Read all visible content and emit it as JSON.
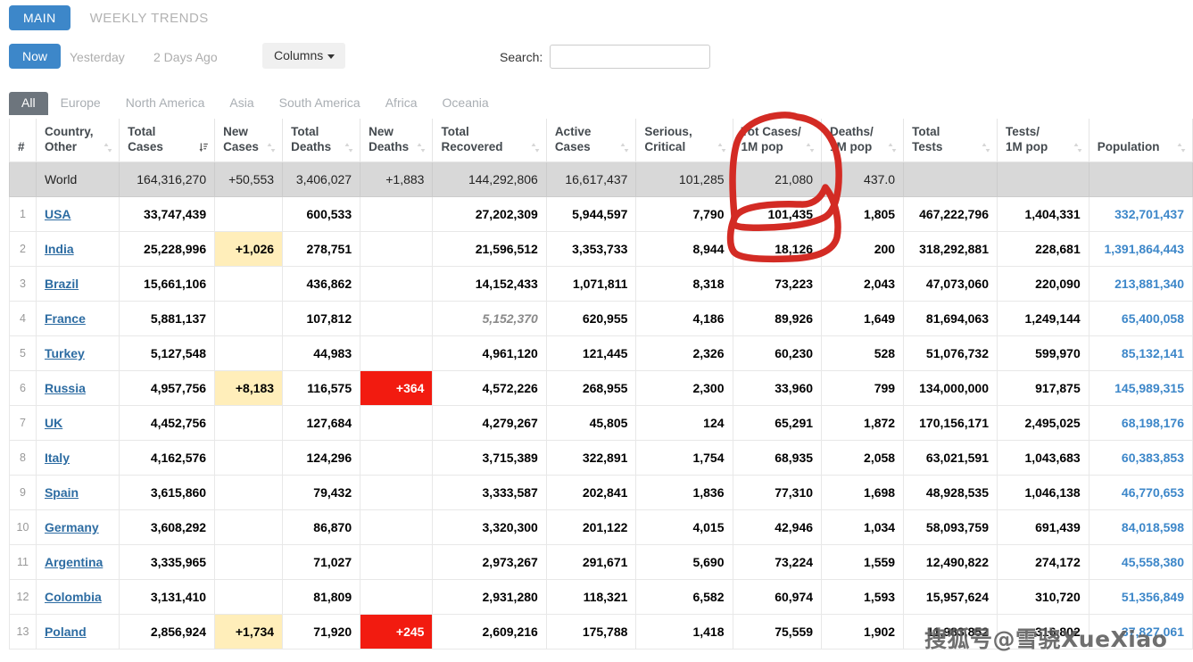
{
  "topnav": {
    "main_tab": "MAIN",
    "weekly_tab": "WEEKLY TRENDS"
  },
  "controls": {
    "now": "Now",
    "yesterday": "Yesterday",
    "two_days_ago": "2 Days Ago",
    "columns_button": "Columns",
    "search_label": "Search:",
    "search_value": "",
    "search_placeholder": ""
  },
  "continent_tabs": [
    {
      "label": "All",
      "active": true
    },
    {
      "label": "Europe",
      "active": false
    },
    {
      "label": "North America",
      "active": false
    },
    {
      "label": "Asia",
      "active": false
    },
    {
      "label": "South America",
      "active": false
    },
    {
      "label": "Africa",
      "active": false
    },
    {
      "label": "Oceania",
      "active": false
    }
  ],
  "columns": [
    {
      "key": "idx",
      "line1": "",
      "line2": "#",
      "sort": "none"
    },
    {
      "key": "country",
      "line1": "Country,",
      "line2": "Other",
      "sort": "both"
    },
    {
      "key": "total_cases",
      "line1": "Total",
      "line2": "Cases",
      "sort": "desc"
    },
    {
      "key": "new_cases",
      "line1": "New",
      "line2": "Cases",
      "sort": "both"
    },
    {
      "key": "total_deaths",
      "line1": "Total",
      "line2": "Deaths",
      "sort": "both"
    },
    {
      "key": "new_deaths",
      "line1": "New",
      "line2": "Deaths",
      "sort": "both"
    },
    {
      "key": "total_recovered",
      "line1": "Total",
      "line2": "Recovered",
      "sort": "both"
    },
    {
      "key": "active_cases",
      "line1": "Active",
      "line2": "Cases",
      "sort": "both"
    },
    {
      "key": "serious_critical",
      "line1": "Serious,",
      "line2": "Critical",
      "sort": "both"
    },
    {
      "key": "tot_cases_1m",
      "line1": "Tot Cases/",
      "line2": "1M pop",
      "sort": "both"
    },
    {
      "key": "deaths_1m",
      "line1": "Deaths/",
      "line2": "1M pop",
      "sort": "both"
    },
    {
      "key": "total_tests",
      "line1": "Total",
      "line2": "Tests",
      "sort": "both"
    },
    {
      "key": "tests_1m",
      "line1": "Tests/",
      "line2": "1M pop",
      "sort": "both"
    },
    {
      "key": "population",
      "line1": "",
      "line2": "Population",
      "sort": "both"
    }
  ],
  "world_row": {
    "idx": "",
    "country": "World",
    "total_cases": "164,316,270",
    "new_cases": "+50,553",
    "total_deaths": "3,406,027",
    "new_deaths": "+1,883",
    "total_recovered": "144,292,806",
    "active_cases": "16,617,437",
    "serious_critical": "101,285",
    "tot_cases_1m": "21,080",
    "deaths_1m": "437.0",
    "total_tests": "",
    "tests_1m": "",
    "population": ""
  },
  "rows": [
    {
      "idx": "1",
      "country": "USA",
      "total_cases": "33,747,439",
      "new_cases": "",
      "new_cases_style": "none",
      "total_deaths": "600,533",
      "new_deaths": "",
      "new_deaths_style": "none",
      "total_recovered": "27,202,309",
      "recovered_style": "normal",
      "active_cases": "5,944,597",
      "serious_critical": "7,790",
      "tot_cases_1m": "101,435",
      "deaths_1m": "1,805",
      "total_tests": "467,222,796",
      "tests_1m": "1,404,331",
      "population": "332,701,437"
    },
    {
      "idx": "2",
      "country": "India",
      "total_cases": "25,228,996",
      "new_cases": "+1,026",
      "new_cases_style": "yellow",
      "total_deaths": "278,751",
      "new_deaths": "",
      "new_deaths_style": "none",
      "total_recovered": "21,596,512",
      "recovered_style": "normal",
      "active_cases": "3,353,733",
      "serious_critical": "8,944",
      "tot_cases_1m": "18,126",
      "deaths_1m": "200",
      "total_tests": "318,292,881",
      "tests_1m": "228,681",
      "population": "1,391,864,443"
    },
    {
      "idx": "3",
      "country": "Brazil",
      "total_cases": "15,661,106",
      "new_cases": "",
      "new_cases_style": "none",
      "total_deaths": "436,862",
      "new_deaths": "",
      "new_deaths_style": "none",
      "total_recovered": "14,152,433",
      "recovered_style": "normal",
      "active_cases": "1,071,811",
      "serious_critical": "8,318",
      "tot_cases_1m": "73,223",
      "deaths_1m": "2,043",
      "total_tests": "47,073,060",
      "tests_1m": "220,090",
      "population": "213,881,340"
    },
    {
      "idx": "4",
      "country": "France",
      "total_cases": "5,881,137",
      "new_cases": "",
      "new_cases_style": "none",
      "total_deaths": "107,812",
      "new_deaths": "",
      "new_deaths_style": "none",
      "total_recovered": "5,152,370",
      "recovered_style": "dim-italic",
      "active_cases": "620,955",
      "serious_critical": "4,186",
      "tot_cases_1m": "89,926",
      "deaths_1m": "1,649",
      "total_tests": "81,694,063",
      "tests_1m": "1,249,144",
      "population": "65,400,058"
    },
    {
      "idx": "5",
      "country": "Turkey",
      "total_cases": "5,127,548",
      "new_cases": "",
      "new_cases_style": "none",
      "total_deaths": "44,983",
      "new_deaths": "",
      "new_deaths_style": "none",
      "total_recovered": "4,961,120",
      "recovered_style": "normal",
      "active_cases": "121,445",
      "serious_critical": "2,326",
      "tot_cases_1m": "60,230",
      "deaths_1m": "528",
      "total_tests": "51,076,732",
      "tests_1m": "599,970",
      "population": "85,132,141"
    },
    {
      "idx": "6",
      "country": "Russia",
      "total_cases": "4,957,756",
      "new_cases": "+8,183",
      "new_cases_style": "yellow",
      "total_deaths": "116,575",
      "new_deaths": "+364",
      "new_deaths_style": "red",
      "total_recovered": "4,572,226",
      "recovered_style": "normal",
      "active_cases": "268,955",
      "serious_critical": "2,300",
      "tot_cases_1m": "33,960",
      "deaths_1m": "799",
      "total_tests": "134,000,000",
      "tests_1m": "917,875",
      "population": "145,989,315"
    },
    {
      "idx": "7",
      "country": "UK",
      "total_cases": "4,452,756",
      "new_cases": "",
      "new_cases_style": "none",
      "total_deaths": "127,684",
      "new_deaths": "",
      "new_deaths_style": "none",
      "total_recovered": "4,279,267",
      "recovered_style": "normal",
      "active_cases": "45,805",
      "serious_critical": "124",
      "tot_cases_1m": "65,291",
      "deaths_1m": "1,872",
      "total_tests": "170,156,171",
      "tests_1m": "2,495,025",
      "population": "68,198,176"
    },
    {
      "idx": "8",
      "country": "Italy",
      "total_cases": "4,162,576",
      "new_cases": "",
      "new_cases_style": "none",
      "total_deaths": "124,296",
      "new_deaths": "",
      "new_deaths_style": "none",
      "total_recovered": "3,715,389",
      "recovered_style": "normal",
      "active_cases": "322,891",
      "serious_critical": "1,754",
      "tot_cases_1m": "68,935",
      "deaths_1m": "2,058",
      "total_tests": "63,021,591",
      "tests_1m": "1,043,683",
      "population": "60,383,853"
    },
    {
      "idx": "9",
      "country": "Spain",
      "total_cases": "3,615,860",
      "new_cases": "",
      "new_cases_style": "none",
      "total_deaths": "79,432",
      "new_deaths": "",
      "new_deaths_style": "none",
      "total_recovered": "3,333,587",
      "recovered_style": "normal",
      "active_cases": "202,841",
      "serious_critical": "1,836",
      "tot_cases_1m": "77,310",
      "deaths_1m": "1,698",
      "total_tests": "48,928,535",
      "tests_1m": "1,046,138",
      "population": "46,770,653"
    },
    {
      "idx": "10",
      "country": "Germany",
      "total_cases": "3,608,292",
      "new_cases": "",
      "new_cases_style": "none",
      "total_deaths": "86,870",
      "new_deaths": "",
      "new_deaths_style": "none",
      "total_recovered": "3,320,300",
      "recovered_style": "normal",
      "active_cases": "201,122",
      "serious_critical": "4,015",
      "tot_cases_1m": "42,946",
      "deaths_1m": "1,034",
      "total_tests": "58,093,759",
      "tests_1m": "691,439",
      "population": "84,018,598"
    },
    {
      "idx": "11",
      "country": "Argentina",
      "total_cases": "3,335,965",
      "new_cases": "",
      "new_cases_style": "none",
      "total_deaths": "71,027",
      "new_deaths": "",
      "new_deaths_style": "none",
      "total_recovered": "2,973,267",
      "recovered_style": "normal",
      "active_cases": "291,671",
      "serious_critical": "5,690",
      "tot_cases_1m": "73,224",
      "deaths_1m": "1,559",
      "total_tests": "12,490,822",
      "tests_1m": "274,172",
      "population": "45,558,380"
    },
    {
      "idx": "12",
      "country": "Colombia",
      "total_cases": "3,131,410",
      "new_cases": "",
      "new_cases_style": "none",
      "total_deaths": "81,809",
      "new_deaths": "",
      "new_deaths_style": "none",
      "total_recovered": "2,931,280",
      "recovered_style": "normal",
      "active_cases": "118,321",
      "serious_critical": "6,582",
      "tot_cases_1m": "60,974",
      "deaths_1m": "1,593",
      "total_tests": "15,957,624",
      "tests_1m": "310,720",
      "population": "51,356,849"
    },
    {
      "idx": "13",
      "country": "Poland",
      "total_cases": "2,856,924",
      "new_cases": "+1,734",
      "new_cases_style": "yellow",
      "total_deaths": "71,920",
      "new_deaths": "+245",
      "new_deaths_style": "red",
      "total_recovered": "2,609,216",
      "recovered_style": "normal",
      "active_cases": "175,788",
      "serious_critical": "1,418",
      "tot_cases_1m": "75,559",
      "deaths_1m": "1,902",
      "total_tests": "11,983,852",
      "tests_1m": "316,802",
      "population": "37,827,061"
    }
  ],
  "annotation": {
    "type": "hand-drawn-red-circle",
    "color": "#d32b24",
    "targets": [
      "Tot Cases/1M pop header",
      "21,080",
      "101,435"
    ]
  },
  "watermark": {
    "text": "搜狐号@雪骁XueXiao"
  },
  "colors": {
    "brand_blue": "#3d87c9",
    "link_blue": "#2d6ca2",
    "population_blue": "#3d87c9",
    "yellow_cell": "#ffeeba",
    "red_cell": "#f21b10",
    "world_row_bg": "#d8d8d8",
    "tab_active_gray": "#6d757d",
    "annotation_red": "#d32b24"
  }
}
